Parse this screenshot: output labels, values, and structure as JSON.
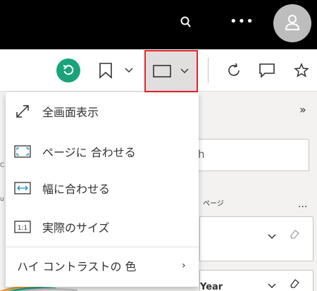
{
  "topbar": {
    "more_label": "•••"
  },
  "toolbar": {
    "view_button": {
      "selected": true
    }
  },
  "view_menu": {
    "items": [
      {
        "label": "全画面表示",
        "icon": "full-screen-icon"
      },
      {
        "label": "ページに 合わせる",
        "icon": "fit-to-page-icon"
      },
      {
        "label": "幅に合わせる",
        "icon": "fit-to-width-icon"
      },
      {
        "label": "実際のサイズ",
        "icon": "actual-size-icon",
        "icon_text": "1:1"
      }
    ],
    "high_contrast": {
      "label": "ハイ コントラストの 色",
      "chevron": "›"
    }
  },
  "right_pane": {
    "collapse_chevron": "»",
    "search_fragment": "h",
    "section_label": "ページ",
    "section_more": "...",
    "card2_fragment": "Year",
    "left_fragment_1": "C",
    "left_fragment_2": "u"
  },
  "colors": {
    "accent": "#1aa37a",
    "highlight_border": "#e0242c",
    "topbar_bg": "#000000",
    "avatar_bg": "#bdbdbd"
  }
}
